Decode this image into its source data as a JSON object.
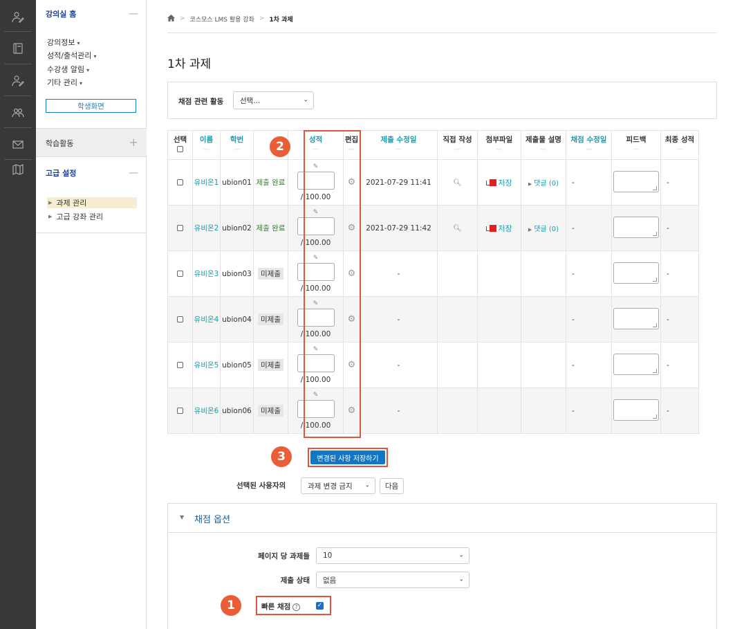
{
  "rail": {
    "icons": [
      "user-edit-icon",
      "book-icon",
      "user-edit-icon",
      "users-icon",
      "mail-icon",
      "map-icon"
    ]
  },
  "sidebar": {
    "home_title": "강의실 홈",
    "home_links": [
      "강의정보",
      "성적/출석관리",
      "수강생 알림",
      "기타 관리"
    ],
    "student_view": "학생화면",
    "activities": "학습활동",
    "advanced": "고급 설정",
    "advanced_items": [
      "과제 관리",
      "고급 강좌 관리"
    ]
  },
  "breadcrumb": {
    "course": "코스모스 LMS 활용 강좌",
    "current": "1차 과제"
  },
  "page_title": "1차 과제",
  "filter": {
    "label": "채점 관련 활동",
    "value": "선택..."
  },
  "table": {
    "headers": {
      "select": "선택",
      "name": "이름",
      "id": "학번",
      "grade": "성적",
      "edit": "편집",
      "modified": "제출 수정일",
      "direct": "직접 작성",
      "file": "첨부파일",
      "desc": "제출물 설명",
      "grade_modified": "채점 수정일",
      "feedback": "피드백",
      "final": "최종 성적"
    },
    "dash": "—",
    "grade_max": "/ 100.00",
    "file_label": "저장",
    "dash_value": "-",
    "rows": [
      {
        "name": "유비온1",
        "id": "ubion01",
        "status": "제출 완료",
        "modified": "2021-07-29 11:41",
        "comment": "댓글 (0)",
        "grade_modified": "-",
        "final": "-"
      },
      {
        "name": "유비온2",
        "id": "ubion02",
        "status": "제출 완료",
        "modified": "2021-07-29 11:42",
        "comment": "댓글 (0)",
        "grade_modified": "-",
        "final": "-"
      },
      {
        "name": "유비온3",
        "id": "ubion03",
        "status": "미제출",
        "modified": "-",
        "comment": "",
        "grade_modified": "-",
        "final": "-"
      },
      {
        "name": "유비온4",
        "id": "ubion04",
        "status": "미제출",
        "modified": "-",
        "comment": "",
        "grade_modified": "-",
        "final": "-"
      },
      {
        "name": "유비온5",
        "id": "ubion05",
        "status": "미제출",
        "modified": "-",
        "comment": "",
        "grade_modified": "-",
        "final": "-"
      },
      {
        "name": "유비온6",
        "id": "ubion06",
        "status": "미제출",
        "modified": "-",
        "comment": "",
        "grade_modified": "-",
        "final": "-"
      }
    ]
  },
  "save_button": "변경된 사항 저장하기",
  "bulk": {
    "label": "선택된 사용자의",
    "value": "과제 변경 금지",
    "next": "다음"
  },
  "options": {
    "title": "채점 옵션",
    "per_page_label": "페이지 당 과제들",
    "per_page_value": "10",
    "status_label": "제출 상태",
    "status_value": "없음",
    "quick_label": "빠른 채점"
  },
  "badges": [
    "1",
    "2",
    "3"
  ],
  "colors": {
    "accent": "#1177c4",
    "link": "#1a9aa8",
    "annotation": "#ea5e37"
  }
}
